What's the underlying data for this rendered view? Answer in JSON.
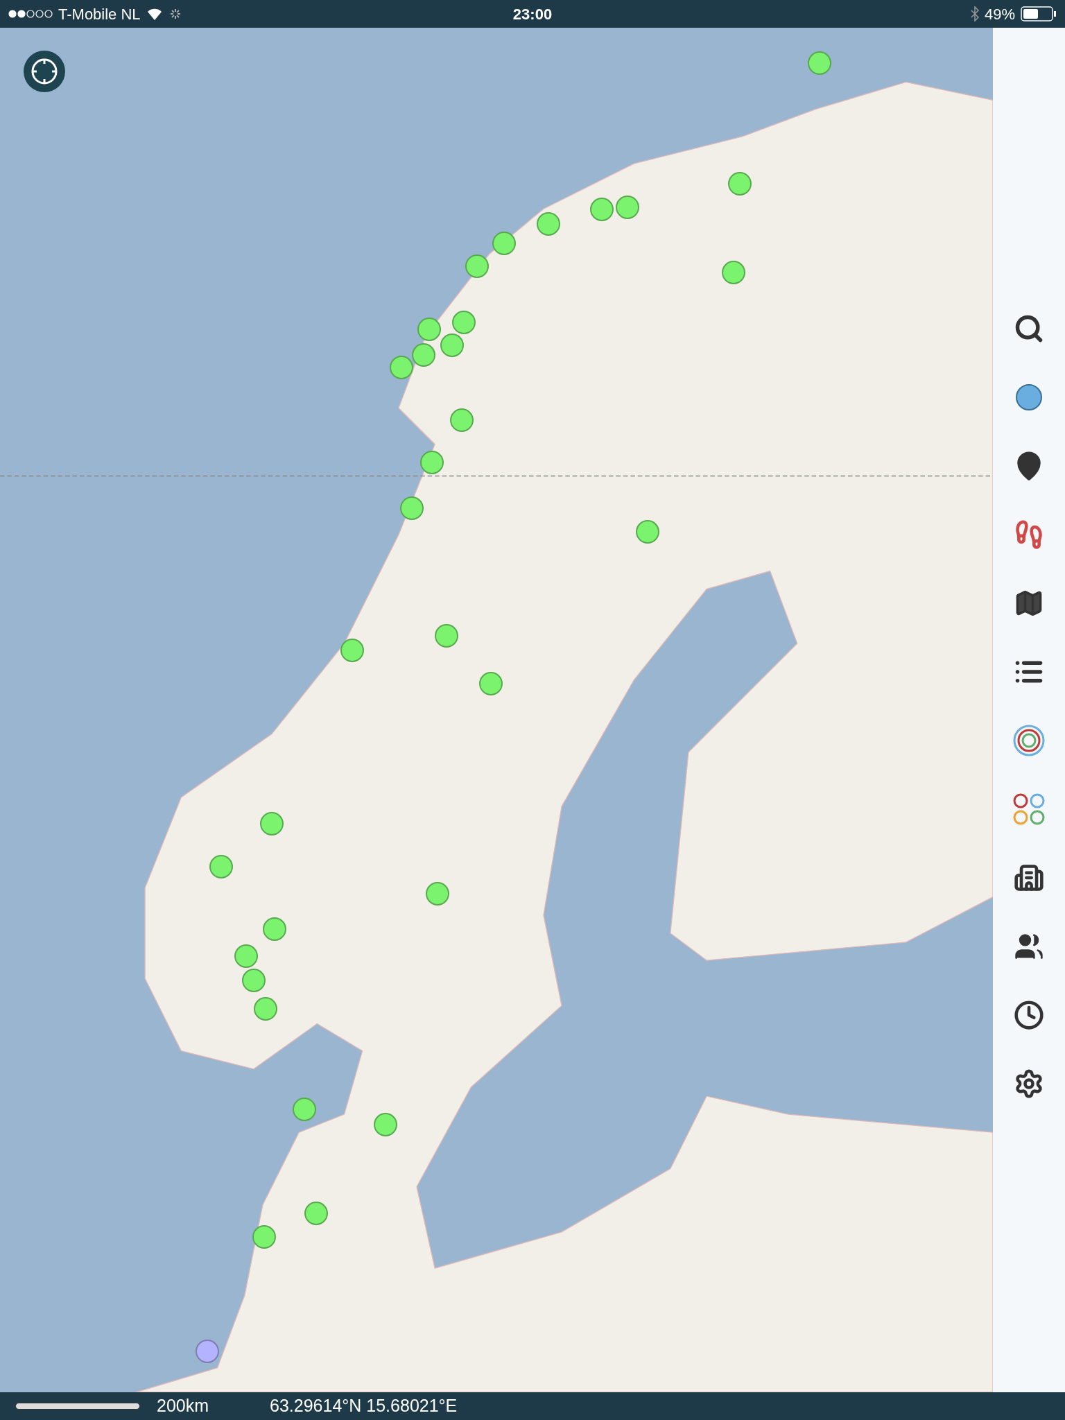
{
  "status_bar": {
    "carrier": "T-Mobile NL",
    "time": "23:00",
    "battery": "49%"
  },
  "map": {
    "pins": [
      {
        "color": "#7cf36f"
      },
      {
        "color": "#7cf36f"
      },
      {
        "color": "#7cf36f"
      },
      {
        "color": "#7cf36f"
      },
      {
        "color": "#7cf36f"
      },
      {
        "color": "#7cf36f"
      },
      {
        "color": "#7cf36f"
      },
      {
        "color": "#7cf36f"
      },
      {
        "color": "#7cf36f"
      },
      {
        "color": "#7cf36f"
      },
      {
        "color": "#7cf36f"
      },
      {
        "color": "#7cf36f"
      },
      {
        "color": "#7cf36f"
      },
      {
        "color": "#7cf36f"
      },
      {
        "color": "#7cf36f"
      },
      {
        "color": "#7cf36f"
      },
      {
        "color": "#7cf36f"
      },
      {
        "color": "#7cf36f"
      },
      {
        "color": "#7cf36f"
      },
      {
        "color": "#7cf36f"
      },
      {
        "color": "#7cf36f"
      },
      {
        "color": "#7cf36f"
      },
      {
        "color": "#7cf36f"
      },
      {
        "color": "#7cf36f"
      },
      {
        "color": "#7cf36f"
      },
      {
        "color": "#7cf36f"
      },
      {
        "color": "#7cf36f"
      },
      {
        "color": "#7cf36f"
      },
      {
        "color": "#7cf36f"
      },
      {
        "color": "#7cf36f"
      },
      {
        "color": "#7cf36f"
      },
      {
        "color": "#b3b3ff"
      }
    ]
  },
  "bottom_bar": {
    "scale": "200km",
    "coordinates": "63.29614°N 15.68021°E"
  }
}
